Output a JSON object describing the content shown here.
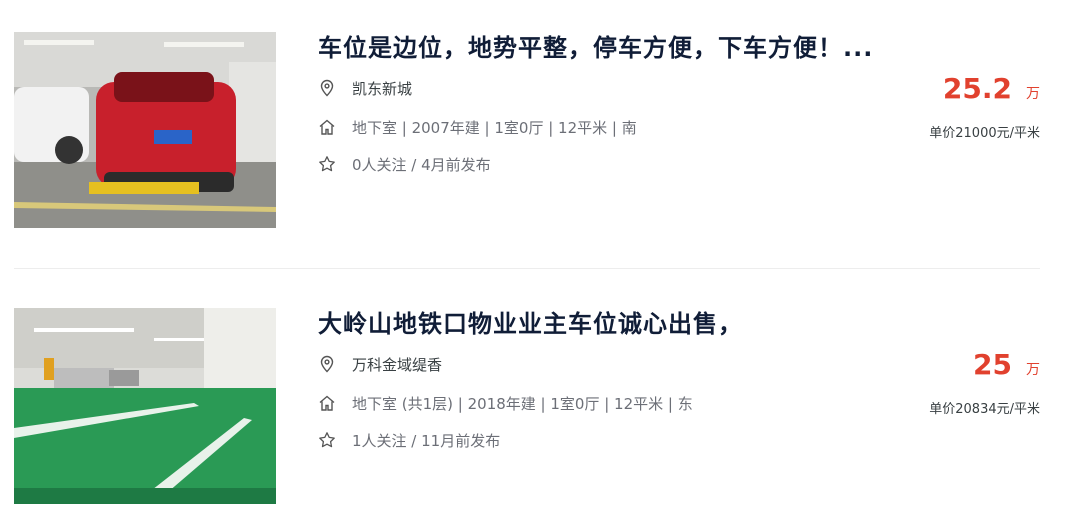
{
  "listings": [
    {
      "title": "车位是边位，地势平整，停车方便，下车方便！...",
      "community": "凯东新城",
      "house_info": "地下室 | 2007年建 | 1室0厅 | 12平米 | 南",
      "follow_info": "0人关注 / 4月前发布",
      "price": "25.2",
      "price_unit": "万",
      "unit_price": "单价21000元/平米",
      "image_icon": "parking-photo-red-car"
    },
    {
      "title": "大岭山地铁口物业业主车位诚心出售，",
      "community": "万科金域缇香",
      "house_info": "地下室 (共1层) | 2018年建 | 1室0厅 | 12平米 | 东",
      "follow_info": "1人关注 / 11月前发布",
      "price": "25",
      "price_unit": "万",
      "unit_price": "单价20834元/平米",
      "image_icon": "parking-photo-green-floor"
    }
  ],
  "icons": {
    "location": "location-pin-icon",
    "house": "house-icon",
    "star": "star-icon"
  },
  "colors": {
    "title": "#101d37",
    "price": "#e1412e",
    "meta": "#6c6f77"
  }
}
